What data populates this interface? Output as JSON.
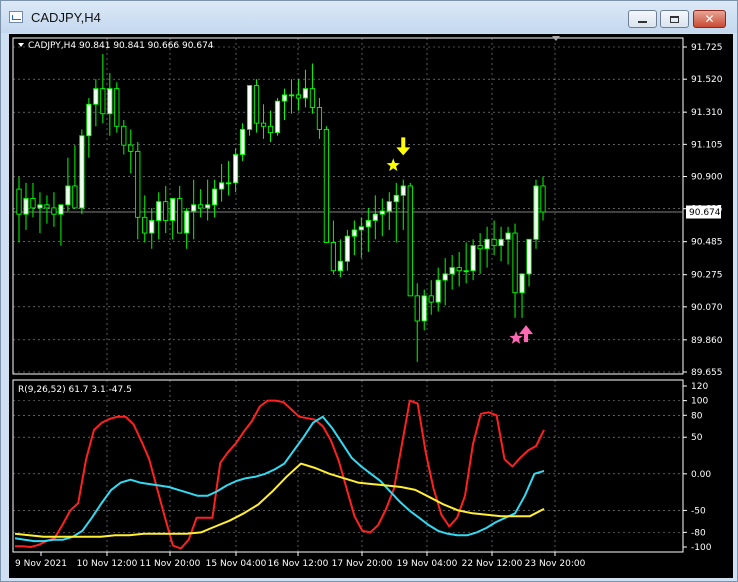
{
  "window": {
    "title": "CADJPY,H4",
    "minimize_label": "minimize",
    "maximize_label": "maximize",
    "close_label": "close"
  },
  "chart_header": "CADJPY,H4  90.841 90.841 90.666 90.674",
  "indicator_header": "R(9,26,52) 61.7 3.1 -47.5",
  "colors": {
    "background": "#000000",
    "axis": "#ffffff",
    "grid": "#c8c8c8",
    "bull_candle": "#ffffff",
    "bear_candle": "#000000",
    "candle_outline": "#00ff00",
    "sell_arrow": "#ffff00",
    "buy_arrow": "#ff69b4",
    "line_fast": "#ff2020",
    "line_mid": "#33d9f0",
    "line_slow": "#ffee33"
  },
  "icons": {
    "sell_signal": "down-arrow-icon",
    "sell_star": "star-icon",
    "buy_signal": "up-arrow-icon",
    "buy_star": "star-icon",
    "chart_menu": "triangle-down-icon"
  },
  "price_axis": {
    "ticks": [
      "91.725",
      "91.520",
      "91.310",
      "91.105",
      "90.900",
      "90.695",
      "90.485",
      "90.275",
      "90.070",
      "89.860",
      "89.655"
    ],
    "current_price": "90.674"
  },
  "indicator_axis": {
    "ticks": [
      "120",
      "100",
      "80",
      "50",
      "0.00",
      "-50",
      "-80",
      "-100"
    ]
  },
  "time_axis": {
    "labels": [
      "9 Nov 2021",
      "10 Nov 12:00",
      "11 Nov 20:00",
      "15 Nov 04:00",
      "16 Nov 12:00",
      "17 Nov 20:00",
      "19 Nov 04:00",
      "22 Nov 12:00",
      "23 Nov 20:00"
    ]
  },
  "chart_data": {
    "type": "candlestick",
    "symbol": "CADJPY",
    "timeframe": "H4",
    "ylim": [
      89.655,
      91.725
    ],
    "last": {
      "open": 90.841,
      "high": 90.841,
      "low": 90.666,
      "close": 90.674
    },
    "candles": [
      [
        90.82,
        90.9,
        90.48,
        90.66
      ],
      [
        90.66,
        90.86,
        90.56,
        90.76
      ],
      [
        90.76,
        90.86,
        90.64,
        90.7
      ],
      [
        90.7,
        90.8,
        90.54,
        90.72
      ],
      [
        90.72,
        90.78,
        90.6,
        90.7
      ],
      [
        90.7,
        90.8,
        90.58,
        90.66
      ],
      [
        90.66,
        90.72,
        90.46,
        90.72
      ],
      [
        90.72,
        91.02,
        90.68,
        90.84
      ],
      [
        90.84,
        91.1,
        90.74,
        90.7
      ],
      [
        90.7,
        91.2,
        90.66,
        91.16
      ],
      [
        91.16,
        91.4,
        91.02,
        91.36
      ],
      [
        91.36,
        91.52,
        91.22,
        91.46
      ],
      [
        91.46,
        91.68,
        91.24,
        91.3
      ],
      [
        91.3,
        91.56,
        91.16,
        91.46
      ],
      [
        91.46,
        91.5,
        91.18,
        91.22
      ],
      [
        91.22,
        91.26,
        91.04,
        91.1
      ],
      [
        91.1,
        91.2,
        90.92,
        91.06
      ],
      [
        91.06,
        91.12,
        90.5,
        90.64
      ],
      [
        90.64,
        90.78,
        90.48,
        90.54
      ],
      [
        90.54,
        90.7,
        90.44,
        90.62
      ],
      [
        90.62,
        90.8,
        90.5,
        90.74
      ],
      [
        90.74,
        90.84,
        90.54,
        90.62
      ],
      [
        90.62,
        90.76,
        90.5,
        90.76
      ],
      [
        90.76,
        90.84,
        90.54,
        90.54
      ],
      [
        90.54,
        90.7,
        90.44,
        90.68
      ],
      [
        90.68,
        90.88,
        90.5,
        90.72
      ],
      [
        90.72,
        90.82,
        90.64,
        90.7
      ],
      [
        90.7,
        90.88,
        90.62,
        90.72
      ],
      [
        90.72,
        90.88,
        90.64,
        90.82
      ],
      [
        90.82,
        90.98,
        90.74,
        90.86
      ],
      [
        90.86,
        91.0,
        90.78,
        90.86
      ],
      [
        90.86,
        91.08,
        90.8,
        91.04
      ],
      [
        91.04,
        91.24,
        91.0,
        91.2
      ],
      [
        91.2,
        91.46,
        91.16,
        91.48
      ],
      [
        91.48,
        91.52,
        91.18,
        91.24
      ],
      [
        91.24,
        91.36,
        91.14,
        91.22
      ],
      [
        91.22,
        91.32,
        91.12,
        91.18
      ],
      [
        91.18,
        91.4,
        91.16,
        91.38
      ],
      [
        91.38,
        91.46,
        91.26,
        91.42
      ],
      [
        91.42,
        91.52,
        91.3,
        91.42
      ],
      [
        91.42,
        91.52,
        91.32,
        91.4
      ],
      [
        91.4,
        91.58,
        91.34,
        91.46
      ],
      [
        91.46,
        91.62,
        91.3,
        91.34
      ],
      [
        91.34,
        91.4,
        91.14,
        91.2
      ],
      [
        91.2,
        91.22,
        90.6,
        90.48
      ],
      [
        90.48,
        90.62,
        90.28,
        90.3
      ],
      [
        90.3,
        90.5,
        90.26,
        90.36
      ],
      [
        90.36,
        90.56,
        90.3,
        90.52
      ],
      [
        90.52,
        90.62,
        90.4,
        90.56
      ],
      [
        90.56,
        90.64,
        90.38,
        90.58
      ],
      [
        90.58,
        90.7,
        90.42,
        90.62
      ],
      [
        90.62,
        90.78,
        90.5,
        90.66
      ],
      [
        90.66,
        90.76,
        90.52,
        90.68
      ],
      [
        90.68,
        90.8,
        90.56,
        90.74
      ],
      [
        90.74,
        90.86,
        90.48,
        90.78
      ],
      [
        90.78,
        90.88,
        90.56,
        90.84
      ],
      [
        90.84,
        90.86,
        90.14,
        90.14
      ],
      [
        90.14,
        90.22,
        89.72,
        89.98
      ],
      [
        89.98,
        90.18,
        89.92,
        90.14
      ],
      [
        90.14,
        90.24,
        90.02,
        90.1
      ],
      [
        90.1,
        90.32,
        90.04,
        90.24
      ],
      [
        90.24,
        90.38,
        90.08,
        90.28
      ],
      [
        90.28,
        90.4,
        90.18,
        90.32
      ],
      [
        90.32,
        90.42,
        90.2,
        90.3
      ],
      [
        90.3,
        90.48,
        90.22,
        90.3
      ],
      [
        90.3,
        90.5,
        90.24,
        90.46
      ],
      [
        90.46,
        90.54,
        90.28,
        90.44
      ],
      [
        90.44,
        90.58,
        90.32,
        90.5
      ],
      [
        90.5,
        90.62,
        90.4,
        90.46
      ],
      [
        90.46,
        90.58,
        90.36,
        90.5
      ],
      [
        90.5,
        90.58,
        90.34,
        90.54
      ],
      [
        90.54,
        90.6,
        90.0,
        90.16
      ],
      [
        90.16,
        90.26,
        90.0,
        90.28
      ],
      [
        90.28,
        90.42,
        90.2,
        90.5
      ],
      [
        90.5,
        90.88,
        90.44,
        90.84
      ],
      [
        90.84,
        90.9,
        90.62,
        90.674
      ]
    ],
    "signals": [
      {
        "type": "sell",
        "index": 55,
        "price": 90.92
      },
      {
        "type": "buy",
        "index": 72,
        "price": 89.96
      }
    ],
    "indicator": {
      "name": "R(9,26,52)",
      "ylim": [
        -100,
        120
      ],
      "series": [
        {
          "name": "R9",
          "values": [
            -99,
            -99,
            -100,
            -97,
            -92,
            -88,
            -70,
            -50,
            -40,
            20,
            60,
            70,
            75,
            78,
            78,
            68,
            45,
            20,
            -20,
            -60,
            -98,
            -102,
            -90,
            -60,
            -60,
            -60,
            15,
            30,
            42,
            58,
            72,
            92,
            100,
            100,
            98,
            88,
            78,
            76,
            74,
            65,
            46,
            18,
            -20,
            -58,
            -78,
            -80,
            -70,
            -48,
            -20,
            40,
            100,
            96,
            30,
            -20,
            -56,
            -72,
            -60,
            -30,
            40,
            82,
            84,
            80,
            20,
            10,
            22,
            32,
            38,
            60
          ]
        },
        {
          "name": "R26",
          "values": [
            -88,
            -90,
            -92,
            -92,
            -90,
            -90,
            -86,
            -78,
            -60,
            -40,
            -22,
            -12,
            -8,
            -12,
            -14,
            -16,
            -18,
            -22,
            -26,
            -30,
            -30,
            -24,
            -16,
            -10,
            -6,
            -4,
            0,
            6,
            14,
            32,
            50,
            70,
            78,
            62,
            42,
            22,
            10,
            0,
            -10,
            -24,
            -38,
            -50,
            -60,
            -70,
            -78,
            -82,
            -84,
            -84,
            -80,
            -74,
            -66,
            -60,
            -54,
            -30,
            0,
            4
          ]
        },
        {
          "name": "R52",
          "values": [
            -82,
            -84,
            -86,
            -86,
            -86,
            -86,
            -86,
            -84,
            -84,
            -82,
            -82,
            -82,
            -82,
            -80,
            -72,
            -64,
            -54,
            -42,
            -24,
            -4,
            14,
            8,
            0,
            -6,
            -12,
            -14,
            -16,
            -18,
            -22,
            -32,
            -42,
            -50,
            -54,
            -56,
            -58,
            -58,
            -58,
            -48
          ]
        }
      ]
    }
  }
}
